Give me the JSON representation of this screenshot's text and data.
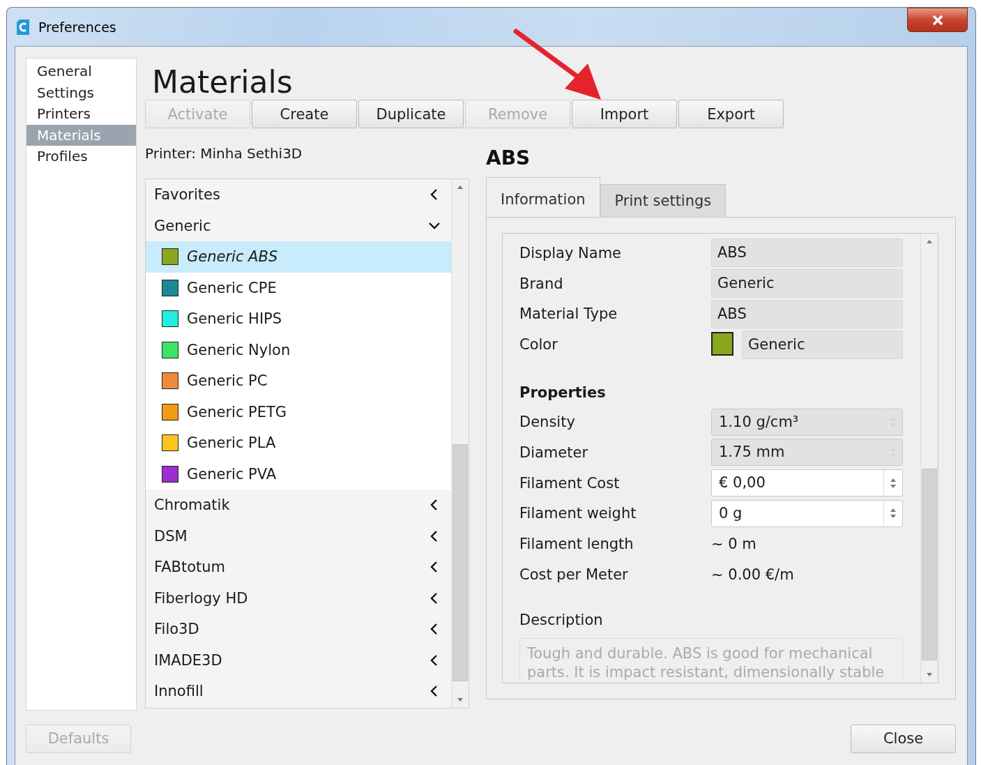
{
  "window": {
    "title": "Preferences"
  },
  "sidebar": {
    "items": [
      {
        "label": "General",
        "selected": false
      },
      {
        "label": "Settings",
        "selected": false
      },
      {
        "label": "Printers",
        "selected": false
      },
      {
        "label": "Materials",
        "selected": true
      },
      {
        "label": "Profiles",
        "selected": false
      }
    ]
  },
  "page_title": "Materials",
  "toolbar": [
    {
      "label": "Activate",
      "disabled": true
    },
    {
      "label": "Create",
      "disabled": false
    },
    {
      "label": "Duplicate",
      "disabled": false
    },
    {
      "label": "Remove",
      "disabled": true
    },
    {
      "label": "Import",
      "disabled": false
    },
    {
      "label": "Export",
      "disabled": false
    }
  ],
  "printer_label": "Printer: Minha Sethi3D",
  "materials_tree": [
    {
      "label": "Favorites",
      "expanded": false
    },
    {
      "label": "Generic",
      "expanded": true,
      "children": [
        {
          "label": "Generic ABS",
          "color": "#8aa61e",
          "selected": true
        },
        {
          "label": "Generic CPE",
          "color": "#1c8a96",
          "selected": false
        },
        {
          "label": "Generic HIPS",
          "color": "#22eedd",
          "selected": false
        },
        {
          "label": "Generic Nylon",
          "color": "#3de268",
          "selected": false
        },
        {
          "label": "Generic PC",
          "color": "#ef8a38",
          "selected": false
        },
        {
          "label": "Generic PETG",
          "color": "#f29a16",
          "selected": false
        },
        {
          "label": "Generic PLA",
          "color": "#fcc521",
          "selected": false
        },
        {
          "label": "Generic PVA",
          "color": "#9b2fcf",
          "selected": false
        }
      ]
    },
    {
      "label": "Chromatik",
      "expanded": false
    },
    {
      "label": "DSM",
      "expanded": false
    },
    {
      "label": "FABtotum",
      "expanded": false
    },
    {
      "label": "Fiberlogy HD",
      "expanded": false
    },
    {
      "label": "Filo3D",
      "expanded": false
    },
    {
      "label": "IMADE3D",
      "expanded": false
    },
    {
      "label": "Innofill",
      "expanded": false
    }
  ],
  "detail": {
    "title": "ABS",
    "tabs": [
      {
        "label": "Information",
        "selected": true
      },
      {
        "label": "Print settings",
        "selected": false
      }
    ],
    "fields": [
      {
        "kind": "text",
        "label": "Display Name",
        "value": "ABS"
      },
      {
        "kind": "text",
        "label": "Brand",
        "value": "Generic"
      },
      {
        "kind": "text",
        "label": "Material Type",
        "value": "ABS"
      },
      {
        "kind": "color",
        "label": "Color",
        "value": "Generic",
        "color": "#8aa61e"
      },
      {
        "kind": "heading",
        "label": "Properties"
      },
      {
        "kind": "spin",
        "label": "Density",
        "value": "1.10 g/cm³",
        "disabled": true
      },
      {
        "kind": "spin",
        "label": "Diameter",
        "value": "1.75 mm",
        "disabled": true
      },
      {
        "kind": "spin",
        "label": "Filament Cost",
        "value": "€ 0,00",
        "disabled": false
      },
      {
        "kind": "spin",
        "label": "Filament weight",
        "value": "0 g",
        "disabled": false
      },
      {
        "kind": "reading",
        "label": "Filament length",
        "value": "~ 0 m"
      },
      {
        "kind": "reading",
        "label": "Cost per Meter",
        "value": "~ 0.00 €/m"
      },
      {
        "kind": "description",
        "label": "Description",
        "placeholder": "Tough and durable. ABS is good for mechanical parts. It is impact resistant, dimensionally stable"
      }
    ]
  },
  "footer": {
    "defaults": {
      "label": "Defaults",
      "disabled": true
    },
    "close": {
      "label": "Close",
      "disabled": false
    }
  }
}
